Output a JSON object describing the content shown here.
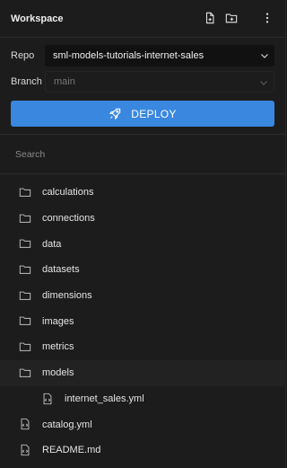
{
  "header": {
    "title": "Workspace",
    "icons": [
      "new-file-icon",
      "new-folder-icon",
      "more-vertical-icon"
    ]
  },
  "repo": {
    "label": "Repo",
    "value": "sml-models-tutorials-internet-sales"
  },
  "branch": {
    "label": "Branch",
    "value": "main"
  },
  "deploy": {
    "label": "DEPLOY",
    "icon": "rocket-icon",
    "color": "#3a87e0"
  },
  "search": {
    "placeholder": "Search",
    "value": ""
  },
  "tree": {
    "items": [
      {
        "label": "calculations",
        "type": "folder"
      },
      {
        "label": "connections",
        "type": "folder"
      },
      {
        "label": "data",
        "type": "folder"
      },
      {
        "label": "datasets",
        "type": "folder"
      },
      {
        "label": "dimensions",
        "type": "folder"
      },
      {
        "label": "images",
        "type": "folder"
      },
      {
        "label": "metrics",
        "type": "folder"
      },
      {
        "label": "models",
        "type": "folder",
        "expanded": true
      },
      {
        "label": "internet_sales.yml",
        "type": "file"
      },
      {
        "label": "catalog.yml",
        "type": "file"
      },
      {
        "label": "README.md",
        "type": "file"
      }
    ]
  }
}
